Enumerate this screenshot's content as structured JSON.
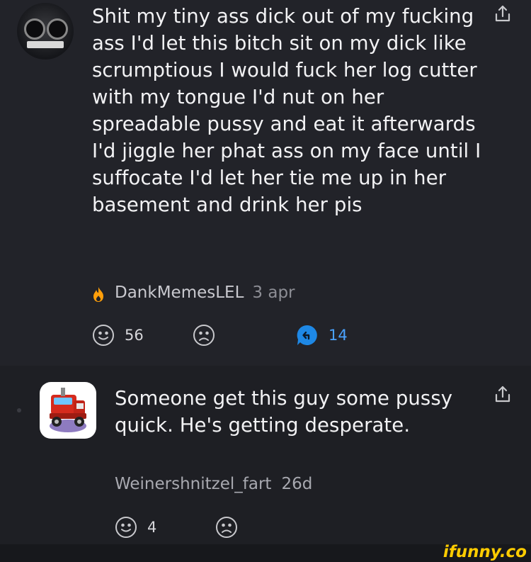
{
  "comment1": {
    "text": "Shit my tiny ass dick out of my fucking ass I'd let this bitch sit on my dick like scrumptious I would fuck her log cutter with my tongue I'd nut on her spreadable pussy and eat it afterwards I'd jiggle her phat ass on my face until I suffocate I'd let her tie me up in her basement and drink her pis",
    "username": "DankMemesLEL",
    "time": "3 apr",
    "smile_count": "56",
    "reply_count": "14",
    "avatar_icon": "car-dashboard-avatar",
    "flame_icon": "flame-icon"
  },
  "comment2": {
    "text": "Someone get this guy some pussy quick. He's getting desperate.",
    "username": "Weinershnitzel_fart",
    "time": "26d",
    "smile_count": "4",
    "avatar_icon": "red-truck-avatar"
  },
  "watermark": "ifunny.co",
  "colors": {
    "background": "#222329",
    "reply_accent": "#1e88e5",
    "flame": "#ff9f0a",
    "watermark": "#ffcc00"
  }
}
